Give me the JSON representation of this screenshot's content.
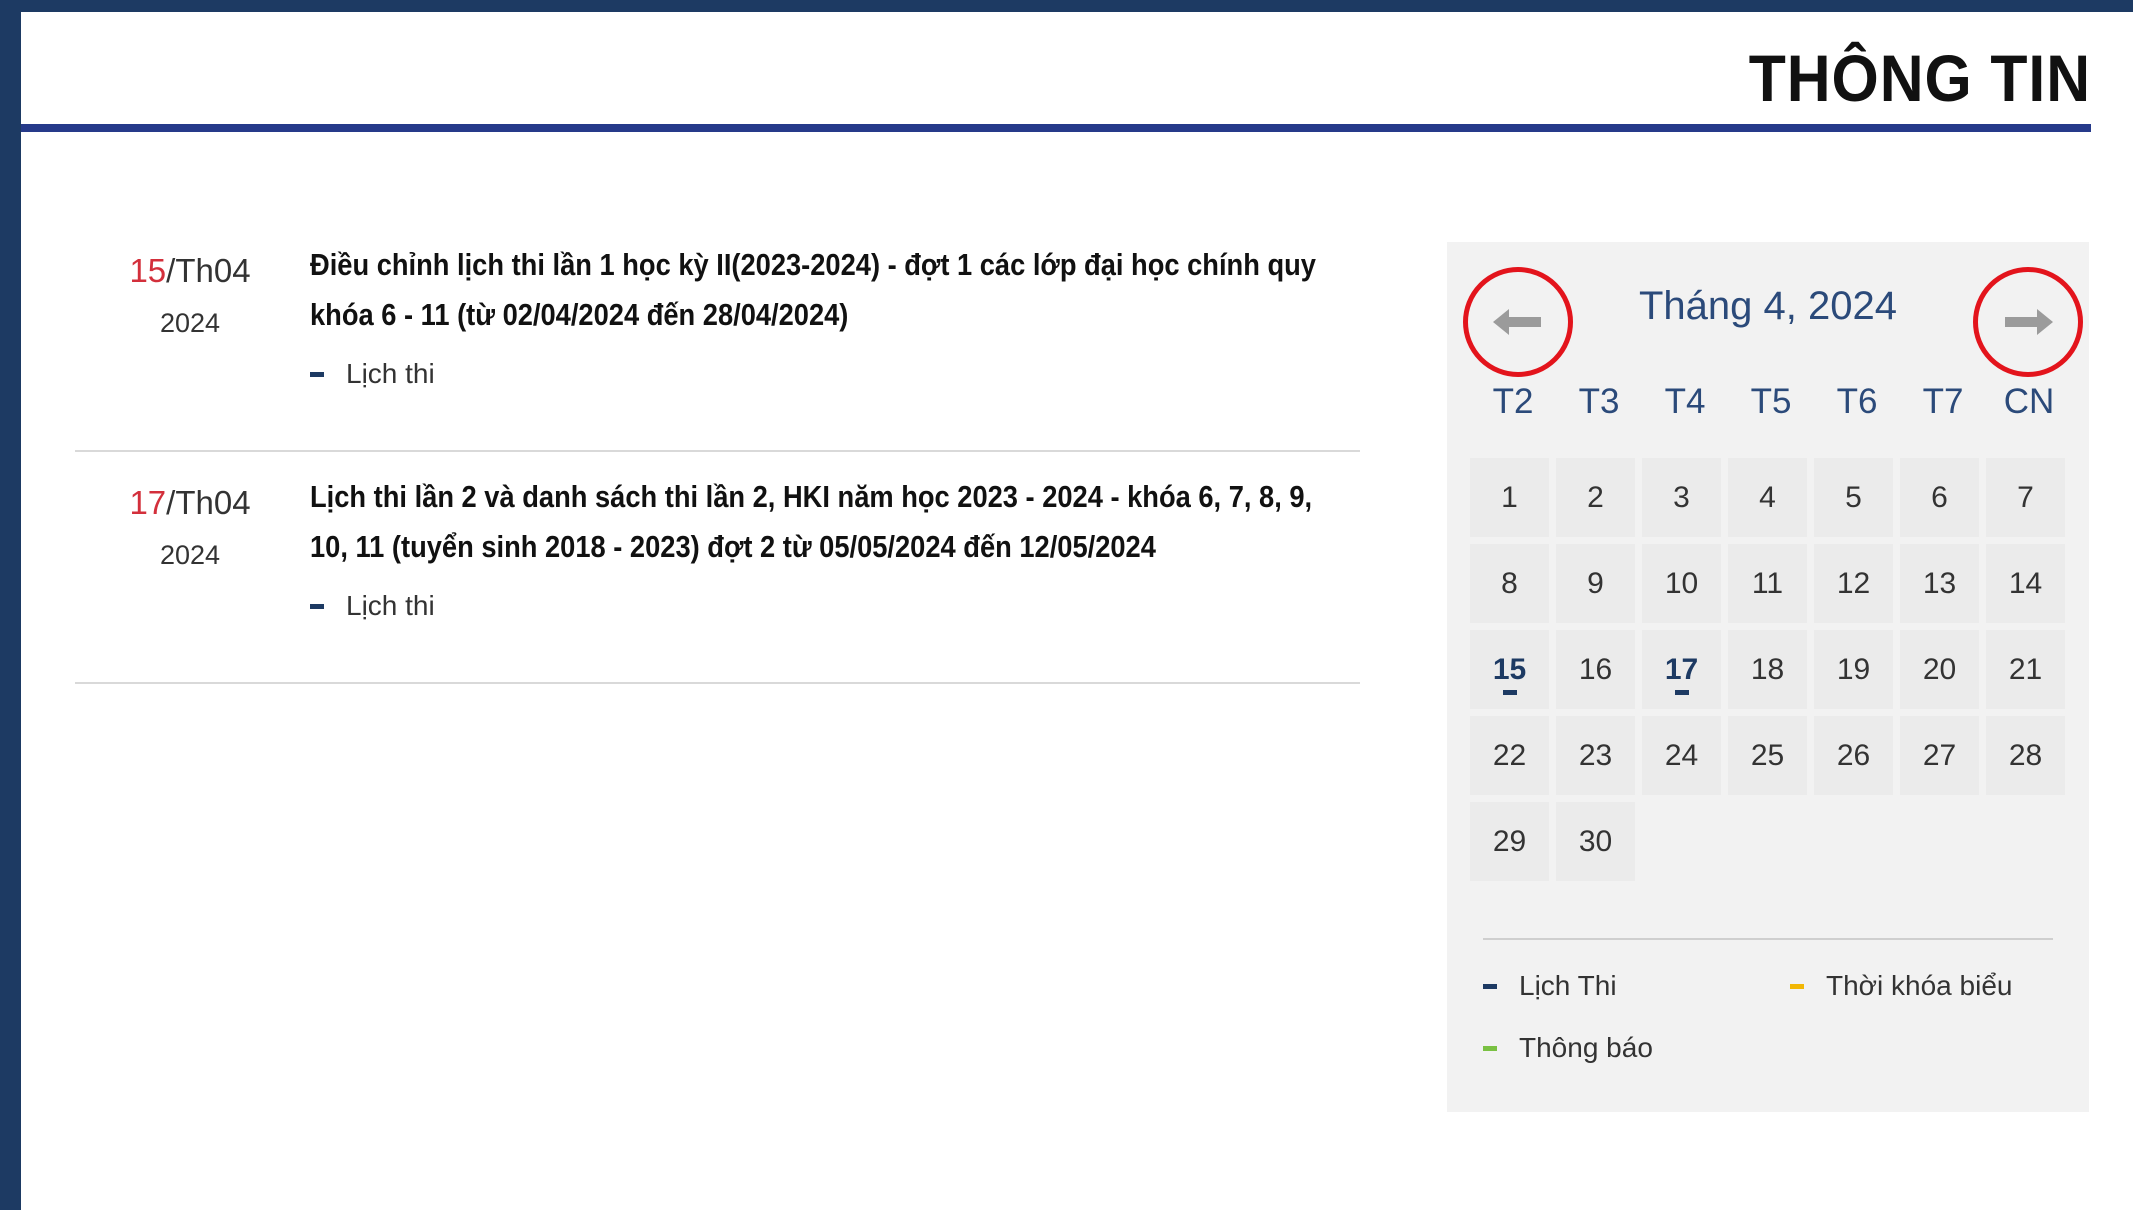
{
  "header": {
    "title": "THÔNG TIN"
  },
  "news": [
    {
      "day": "15",
      "month": "/Th04",
      "year": "2024",
      "title": "Điều chỉnh lịch thi lần 1 học kỳ II(2023-2024) - đợt 1 các lớp đại học chính quy khóa 6 - 11 (từ 02/04/2024 đến 28/04/2024)",
      "category": "Lịch thi"
    },
    {
      "day": "17",
      "month": "/Th04",
      "year": "2024",
      "title": "Lịch thi lần 2 và danh sách thi lần 2, HKI năm học 2023 - 2024 - khóa 6, 7, 8, 9, 10, 11 (tuyển sinh 2018 - 2023) đợt 2 từ 05/05/2024 đến 12/05/2024",
      "category": "Lịch thi"
    }
  ],
  "calendar": {
    "month_label": "Tháng 4, 2024",
    "prev_icon": "arrow-left-icon",
    "next_icon": "arrow-right-icon",
    "weekdays": [
      "T2",
      "T3",
      "T4",
      "T5",
      "T6",
      "T7",
      "CN"
    ],
    "days": [
      "1",
      "2",
      "3",
      "4",
      "5",
      "6",
      "7",
      "8",
      "9",
      "10",
      "11",
      "12",
      "13",
      "14",
      "15",
      "16",
      "17",
      "18",
      "19",
      "20",
      "21",
      "22",
      "23",
      "24",
      "25",
      "26",
      "27",
      "28",
      "29",
      "30"
    ],
    "event_days": [
      "15",
      "17"
    ],
    "legend": [
      {
        "label": "Lịch Thi",
        "color": "#1d3a63"
      },
      {
        "label": "Thời khóa biểu",
        "color": "#f2b705"
      },
      {
        "label": "Thông báo",
        "color": "#7ac143"
      }
    ]
  },
  "colors": {
    "frame": "#1d3a63",
    "header_rule": "#263a8a",
    "date_day": "#d32f3b",
    "calendar_text": "#2b4a7a",
    "nav_highlight": "#e3141c"
  }
}
